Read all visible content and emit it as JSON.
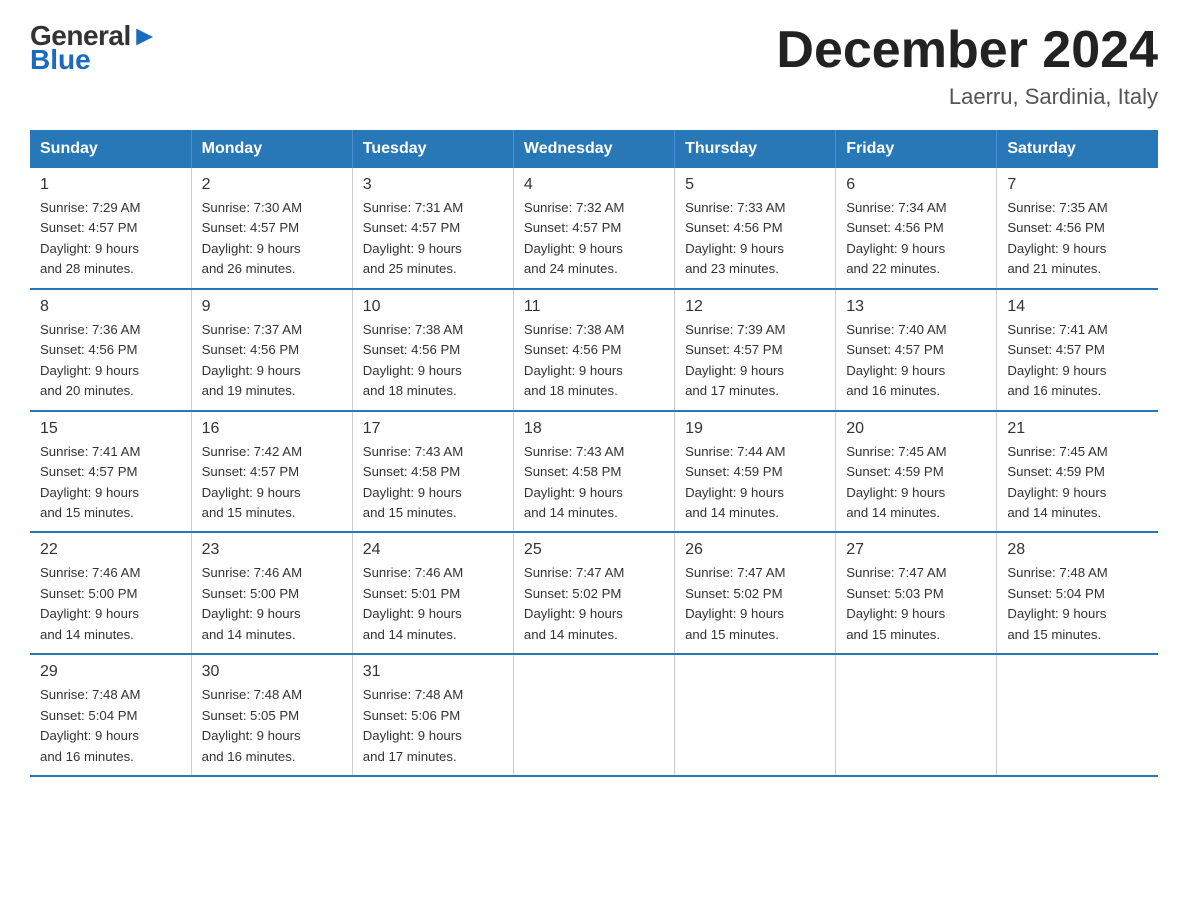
{
  "header": {
    "logo_general": "General",
    "logo_blue": "Blue",
    "title": "December 2024",
    "location": "Laerru, Sardinia, Italy"
  },
  "weekdays": [
    "Sunday",
    "Monday",
    "Tuesday",
    "Wednesday",
    "Thursday",
    "Friday",
    "Saturday"
  ],
  "weeks": [
    [
      {
        "day": "1",
        "sunrise": "7:29 AM",
        "sunset": "4:57 PM",
        "daylight": "9 hours and 28 minutes."
      },
      {
        "day": "2",
        "sunrise": "7:30 AM",
        "sunset": "4:57 PM",
        "daylight": "9 hours and 26 minutes."
      },
      {
        "day": "3",
        "sunrise": "7:31 AM",
        "sunset": "4:57 PM",
        "daylight": "9 hours and 25 minutes."
      },
      {
        "day": "4",
        "sunrise": "7:32 AM",
        "sunset": "4:57 PM",
        "daylight": "9 hours and 24 minutes."
      },
      {
        "day": "5",
        "sunrise": "7:33 AM",
        "sunset": "4:56 PM",
        "daylight": "9 hours and 23 minutes."
      },
      {
        "day": "6",
        "sunrise": "7:34 AM",
        "sunset": "4:56 PM",
        "daylight": "9 hours and 22 minutes."
      },
      {
        "day": "7",
        "sunrise": "7:35 AM",
        "sunset": "4:56 PM",
        "daylight": "9 hours and 21 minutes."
      }
    ],
    [
      {
        "day": "8",
        "sunrise": "7:36 AM",
        "sunset": "4:56 PM",
        "daylight": "9 hours and 20 minutes."
      },
      {
        "day": "9",
        "sunrise": "7:37 AM",
        "sunset": "4:56 PM",
        "daylight": "9 hours and 19 minutes."
      },
      {
        "day": "10",
        "sunrise": "7:38 AM",
        "sunset": "4:56 PM",
        "daylight": "9 hours and 18 minutes."
      },
      {
        "day": "11",
        "sunrise": "7:38 AM",
        "sunset": "4:56 PM",
        "daylight": "9 hours and 18 minutes."
      },
      {
        "day": "12",
        "sunrise": "7:39 AM",
        "sunset": "4:57 PM",
        "daylight": "9 hours and 17 minutes."
      },
      {
        "day": "13",
        "sunrise": "7:40 AM",
        "sunset": "4:57 PM",
        "daylight": "9 hours and 16 minutes."
      },
      {
        "day": "14",
        "sunrise": "7:41 AM",
        "sunset": "4:57 PM",
        "daylight": "9 hours and 16 minutes."
      }
    ],
    [
      {
        "day": "15",
        "sunrise": "7:41 AM",
        "sunset": "4:57 PM",
        "daylight": "9 hours and 15 minutes."
      },
      {
        "day": "16",
        "sunrise": "7:42 AM",
        "sunset": "4:57 PM",
        "daylight": "9 hours and 15 minutes."
      },
      {
        "day": "17",
        "sunrise": "7:43 AM",
        "sunset": "4:58 PM",
        "daylight": "9 hours and 15 minutes."
      },
      {
        "day": "18",
        "sunrise": "7:43 AM",
        "sunset": "4:58 PM",
        "daylight": "9 hours and 14 minutes."
      },
      {
        "day": "19",
        "sunrise": "7:44 AM",
        "sunset": "4:59 PM",
        "daylight": "9 hours and 14 minutes."
      },
      {
        "day": "20",
        "sunrise": "7:45 AM",
        "sunset": "4:59 PM",
        "daylight": "9 hours and 14 minutes."
      },
      {
        "day": "21",
        "sunrise": "7:45 AM",
        "sunset": "4:59 PM",
        "daylight": "9 hours and 14 minutes."
      }
    ],
    [
      {
        "day": "22",
        "sunrise": "7:46 AM",
        "sunset": "5:00 PM",
        "daylight": "9 hours and 14 minutes."
      },
      {
        "day": "23",
        "sunrise": "7:46 AM",
        "sunset": "5:00 PM",
        "daylight": "9 hours and 14 minutes."
      },
      {
        "day": "24",
        "sunrise": "7:46 AM",
        "sunset": "5:01 PM",
        "daylight": "9 hours and 14 minutes."
      },
      {
        "day": "25",
        "sunrise": "7:47 AM",
        "sunset": "5:02 PM",
        "daylight": "9 hours and 14 minutes."
      },
      {
        "day": "26",
        "sunrise": "7:47 AM",
        "sunset": "5:02 PM",
        "daylight": "9 hours and 15 minutes."
      },
      {
        "day": "27",
        "sunrise": "7:47 AM",
        "sunset": "5:03 PM",
        "daylight": "9 hours and 15 minutes."
      },
      {
        "day": "28",
        "sunrise": "7:48 AM",
        "sunset": "5:04 PM",
        "daylight": "9 hours and 15 minutes."
      }
    ],
    [
      {
        "day": "29",
        "sunrise": "7:48 AM",
        "sunset": "5:04 PM",
        "daylight": "9 hours and 16 minutes."
      },
      {
        "day": "30",
        "sunrise": "7:48 AM",
        "sunset": "5:05 PM",
        "daylight": "9 hours and 16 minutes."
      },
      {
        "day": "31",
        "sunrise": "7:48 AM",
        "sunset": "5:06 PM",
        "daylight": "9 hours and 17 minutes."
      },
      {
        "day": "",
        "sunrise": "",
        "sunset": "",
        "daylight": ""
      },
      {
        "day": "",
        "sunrise": "",
        "sunset": "",
        "daylight": ""
      },
      {
        "day": "",
        "sunrise": "",
        "sunset": "",
        "daylight": ""
      },
      {
        "day": "",
        "sunrise": "",
        "sunset": "",
        "daylight": ""
      }
    ]
  ],
  "labels": {
    "sunrise": "Sunrise:",
    "sunset": "Sunset:",
    "daylight": "Daylight:"
  }
}
